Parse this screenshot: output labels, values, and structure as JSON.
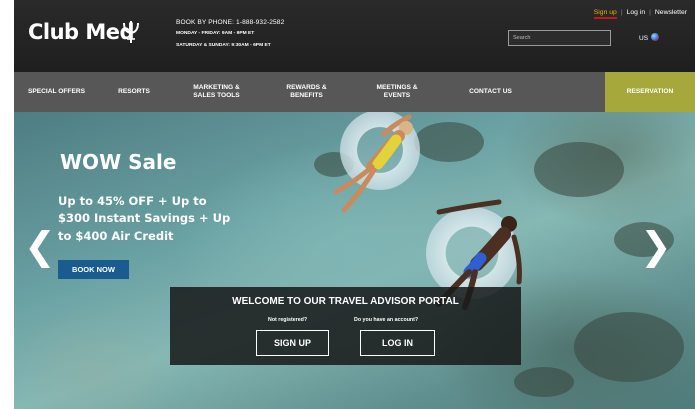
{
  "header": {
    "brand": "Club Med",
    "phone": "BOOK BY PHONE: 1-888-932-2582",
    "hours_weekday": "MONDAY - FRIDAY: 9AM - 9PM ET",
    "hours_weekend": "SATURDAY & SUNDAY: 9:30AM - 6PM ET",
    "links": {
      "signup": "Sign up",
      "login": "Log in",
      "newsletter": "Newsletter",
      "separator": "|"
    },
    "search_placeholder": "Search",
    "country": "US"
  },
  "nav": {
    "items": [
      {
        "label": "SPECIAL OFFERS"
      },
      {
        "label": "RESORTS"
      },
      {
        "label": "MARKETING &\nSALES TOOLS"
      },
      {
        "label": "REWARDS &\nBENEFITS"
      },
      {
        "label": "MEETINGS &\nEVENTS"
      },
      {
        "label": "CONTACT US"
      },
      {
        "label": "RESERVATION"
      }
    ]
  },
  "hero": {
    "title": "WOW Sale",
    "text": "Up to 45% OFF + Up to $300 Instant Savings + Up to $400 Air Credit",
    "cta": "BOOK NOW",
    "prev_arrow": "❮",
    "next_arrow": "❯"
  },
  "portal": {
    "title": "WELCOME TO OUR TRAVEL ADVISOR PORTAL",
    "question_register": "Not registered?",
    "question_account": "Do you have an account?",
    "signup_label": "SIGN UP",
    "login_label": "LOG IN"
  },
  "colors": {
    "header_bg": "#222222",
    "nav_bg": "#575757",
    "reservation_bg": "#a6a83b",
    "cta_bg": "#1a5c8f",
    "signup_link": "#e8b400"
  }
}
